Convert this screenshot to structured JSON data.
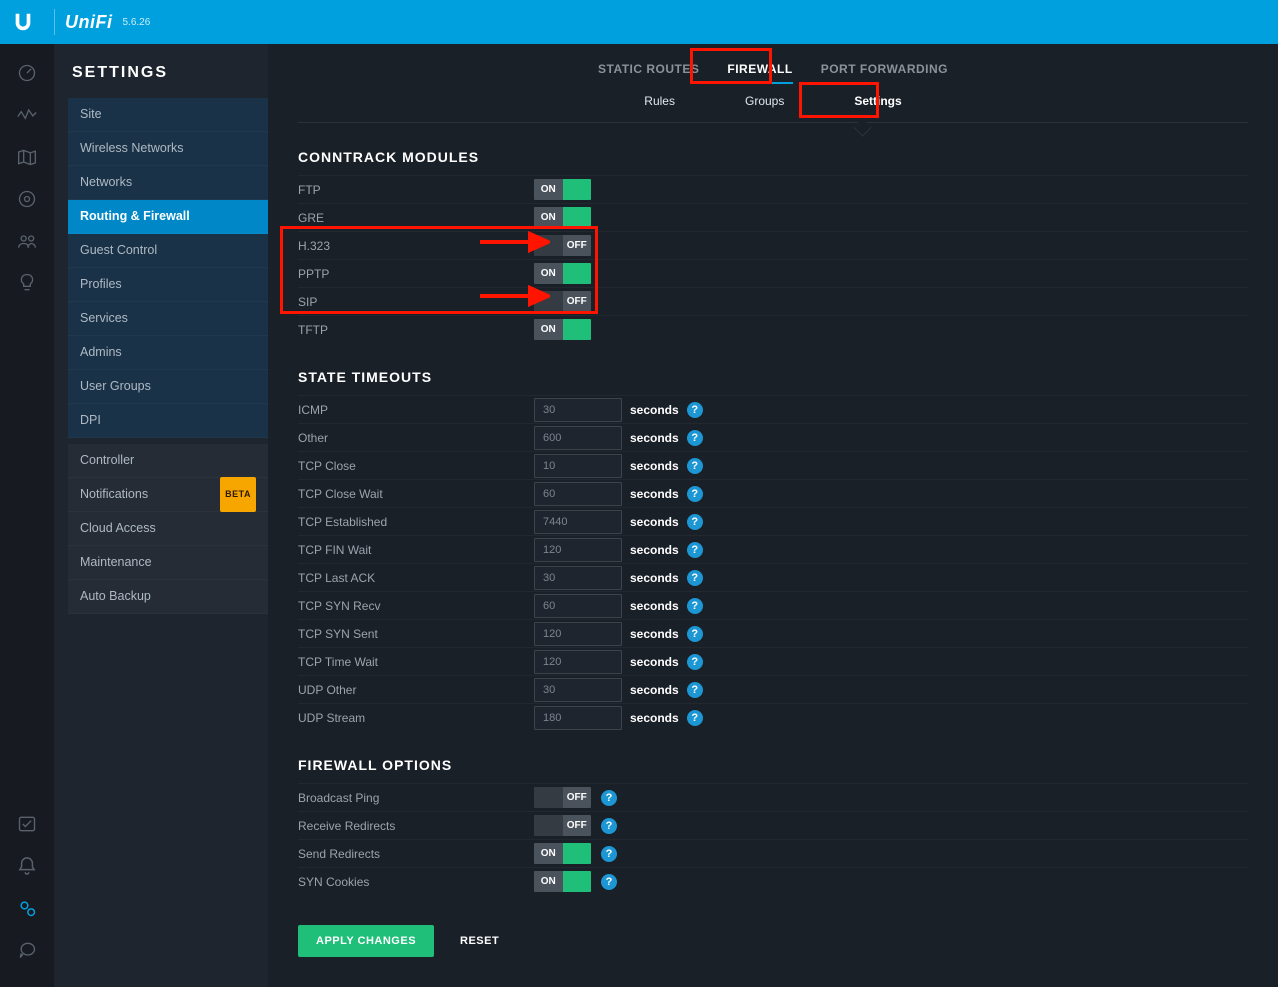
{
  "topbar": {
    "brand": "UniFi",
    "version": "5.6.26"
  },
  "sidebar": {
    "heading": "SETTINGS",
    "groups": [
      {
        "items": [
          {
            "label": "Site"
          },
          {
            "label": "Wireless Networks"
          },
          {
            "label": "Networks"
          },
          {
            "label": "Routing & Firewall",
            "active": true
          },
          {
            "label": "Guest Control"
          },
          {
            "label": "Profiles"
          },
          {
            "label": "Services"
          },
          {
            "label": "Admins"
          },
          {
            "label": "User Groups"
          },
          {
            "label": "DPI"
          }
        ]
      },
      {
        "items": [
          {
            "label": "Controller"
          },
          {
            "label": "Notifications",
            "badge": "BETA"
          },
          {
            "label": "Cloud Access"
          },
          {
            "label": "Maintenance"
          },
          {
            "label": "Auto Backup"
          }
        ]
      }
    ]
  },
  "topnav": [
    {
      "label": "STATIC ROUTES"
    },
    {
      "label": "FIREWALL",
      "active": true
    },
    {
      "label": "PORT FORWARDING"
    }
  ],
  "subnav": [
    {
      "label": "Rules"
    },
    {
      "label": "Groups"
    },
    {
      "label": "Settings",
      "active": true
    }
  ],
  "toggle_labels": {
    "on": "ON",
    "off": "OFF"
  },
  "sections": {
    "conntrack": {
      "title": "CONNTRACK MODULES",
      "items": [
        {
          "label": "FTP",
          "state": "on"
        },
        {
          "label": "GRE",
          "state": "on"
        },
        {
          "label": "H.323",
          "state": "off"
        },
        {
          "label": "PPTP",
          "state": "on"
        },
        {
          "label": "SIP",
          "state": "off"
        },
        {
          "label": "TFTP",
          "state": "on"
        }
      ]
    },
    "timeouts": {
      "title": "STATE TIMEOUTS",
      "unit": "seconds",
      "items": [
        {
          "label": "ICMP",
          "value": "30"
        },
        {
          "label": "Other",
          "value": "600"
        },
        {
          "label": "TCP Close",
          "value": "10"
        },
        {
          "label": "TCP Close Wait",
          "value": "60"
        },
        {
          "label": "TCP Established",
          "value": "7440"
        },
        {
          "label": "TCP FIN Wait",
          "value": "120"
        },
        {
          "label": "TCP Last ACK",
          "value": "30"
        },
        {
          "label": "TCP SYN Recv",
          "value": "60"
        },
        {
          "label": "TCP SYN Sent",
          "value": "120"
        },
        {
          "label": "TCP Time Wait",
          "value": "120"
        },
        {
          "label": "UDP Other",
          "value": "30"
        },
        {
          "label": "UDP Stream",
          "value": "180"
        }
      ]
    },
    "fwoptions": {
      "title": "FIREWALL OPTIONS",
      "items": [
        {
          "label": "Broadcast Ping",
          "state": "off",
          "help": true
        },
        {
          "label": "Receive Redirects",
          "state": "off",
          "help": true
        },
        {
          "label": "Send Redirects",
          "state": "on",
          "help": true
        },
        {
          "label": "SYN Cookies",
          "state": "on",
          "help": true
        }
      ]
    }
  },
  "buttons": {
    "apply": "APPLY CHANGES",
    "reset": "RESET"
  },
  "help_glyph": "?"
}
